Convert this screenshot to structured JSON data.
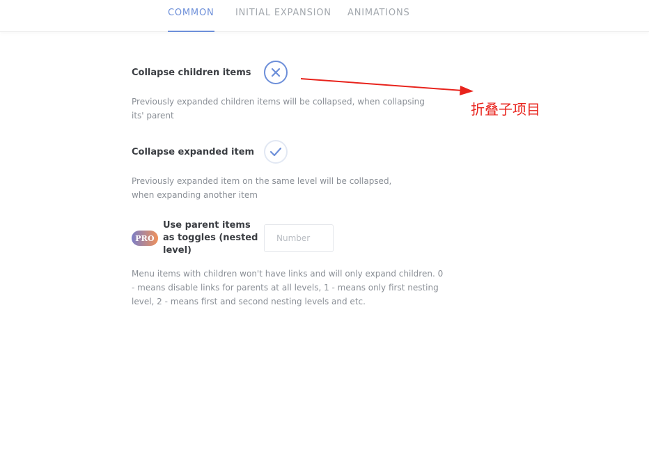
{
  "tabs": [
    {
      "label": "COMMON",
      "active": true
    },
    {
      "label": "INITIAL EXPANSION",
      "active": false
    },
    {
      "label": "ANIMATIONS",
      "active": false
    }
  ],
  "settings": {
    "collapse_children": {
      "label": "Collapse children items",
      "state": "off",
      "icon": "close-icon",
      "description": "Previously expanded children items will be collapsed, when collapsing its' parent"
    },
    "collapse_expanded": {
      "label": "Collapse expanded item",
      "state": "on",
      "icon": "check-icon",
      "description": "Previously expanded item on the same level will be collapsed, when expanding another item"
    },
    "parent_toggles": {
      "badge": "PRO",
      "label": "Use parent items as toggles (nested level)",
      "input_placeholder": "Number",
      "input_value": "",
      "description": "Menu items with children won't have links and will only expand children. 0 - means disable links for parents at all levels, 1 - means only first nesting level, 2 - means first and second nesting levels and etc."
    }
  },
  "annotation": {
    "text": "折叠子项目",
    "color": "#e8231c"
  },
  "colors": {
    "accent": "#6d8fd9",
    "muted_text": "#8a8f96",
    "label_text": "#3a3d42"
  }
}
